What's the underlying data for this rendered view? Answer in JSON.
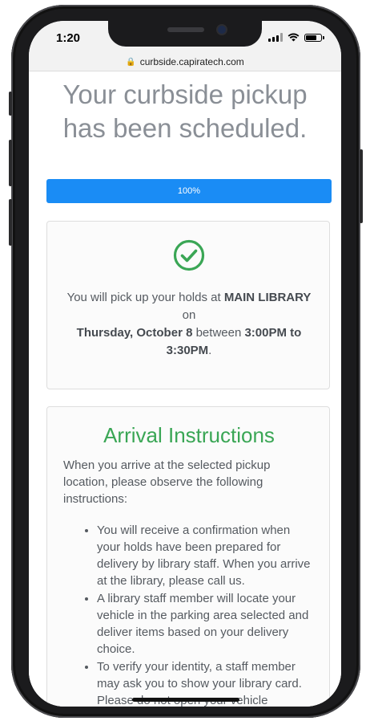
{
  "status_bar": {
    "time": "1:20"
  },
  "browser": {
    "url": "curbside.capiratech.com"
  },
  "page": {
    "headline": "Your curbside pickup has been scheduled.",
    "progress": {
      "label": "100%",
      "value": 100,
      "color": "#1a8cf5"
    },
    "confirmation": {
      "icon": "check-circle-icon",
      "icon_color": "#3aa655",
      "text_prefix": "You will pick up your holds at ",
      "location": "MAIN LIBRARY",
      "text_on": " on",
      "date": "Thursday, October 8",
      "text_between": " between ",
      "time_range": "3:00PM to 3:30PM",
      "text_end": "."
    },
    "arrival": {
      "title": "Arrival Instructions",
      "title_color": "#3aa655",
      "intro": "When you arrive at the selected pickup location, please observe the following instructions:",
      "items": [
        "You will receive a confirmation when your holds have been prepared for delivery by library staff. When you arrive at the library, please call us.",
        "A library staff member will locate your vehicle in the parking area selected and deliver items based on your delivery choice.",
        "To verify your identity, a staff member may ask you to show your library card. Please do not open your vehicle"
      ]
    }
  }
}
